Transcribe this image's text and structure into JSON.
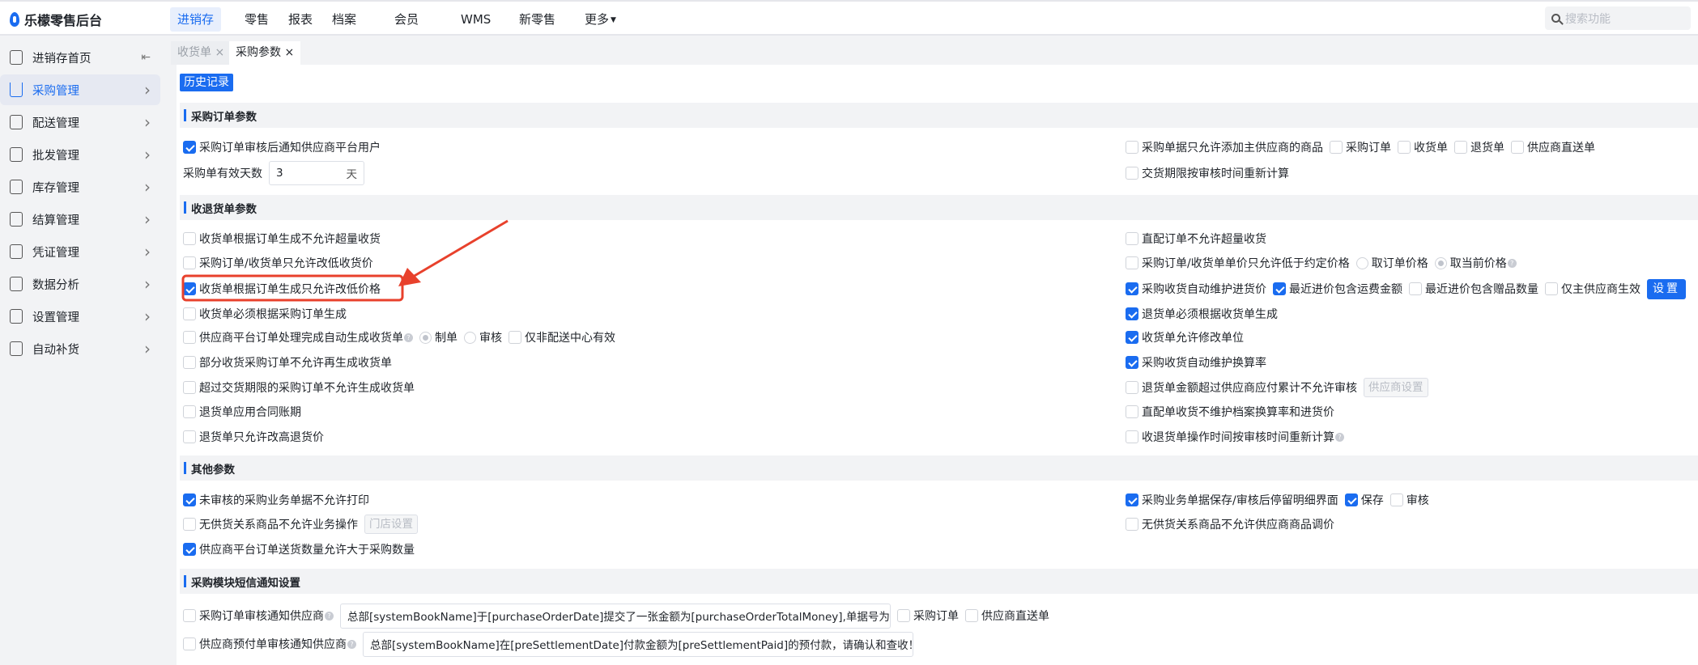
{
  "app": {
    "title": "乐檬零售后台"
  },
  "nav": {
    "items": [
      "进销存",
      "零售",
      "报表",
      "档案",
      "会员",
      "WMS",
      "新零售",
      "更多"
    ],
    "active": 0,
    "search_placeholder": "搜索功能"
  },
  "sidebar": {
    "items": [
      {
        "label": "进销存首页",
        "icon": "home-icon"
      },
      {
        "label": "采购管理",
        "icon": "cart-icon",
        "active": true
      },
      {
        "label": "配送管理",
        "icon": "map-icon"
      },
      {
        "label": "批发管理",
        "icon": "server-icon"
      },
      {
        "label": "库存管理",
        "icon": "box-icon"
      },
      {
        "label": "结算管理",
        "icon": "dollar-icon"
      },
      {
        "label": "凭证管理",
        "icon": "document-icon"
      },
      {
        "label": "数据分析",
        "icon": "chart-line-icon"
      },
      {
        "label": "设置管理",
        "icon": "settings-icon"
      },
      {
        "label": "自动补货",
        "icon": "replenish-icon"
      }
    ]
  },
  "tabs": [
    {
      "label": "收货单",
      "active": false
    },
    {
      "label": "采购参数",
      "active": true
    }
  ],
  "history_button": "历史记录",
  "sections": [
    {
      "title": "采购订单参数",
      "left": [
        [
          {
            "t": "cb",
            "label": "采购订单审核后通知供应商平台用户",
            "on": true
          }
        ],
        [
          {
            "t": "text",
            "label": "采购单有效天数"
          },
          {
            "t": "input",
            "value": "3",
            "unit": "天"
          }
        ]
      ],
      "right": [
        [
          {
            "t": "cb",
            "label": "采购单据只允许添加主供应商的商品"
          },
          {
            "t": "cb",
            "label": "采购订单"
          },
          {
            "t": "cb",
            "label": "收货单"
          },
          {
            "t": "cb",
            "label": "退货单"
          },
          {
            "t": "cb",
            "label": "供应商直送单"
          }
        ],
        [
          {
            "t": "cb",
            "label": "交货期限按审核时间重新计算"
          }
        ]
      ]
    },
    {
      "title": "收退货单参数",
      "left": [
        [
          {
            "t": "cb",
            "label": "收货单根据订单生成不允许超量收货"
          }
        ],
        [
          {
            "t": "cb",
            "label": "采购订单/收货单只允许改低收货价"
          }
        ],
        [
          {
            "t": "cb",
            "label": "收货单根据订单生成只允许改低价格",
            "on": true
          }
        ],
        [
          {
            "t": "cb",
            "label": "收货单必须根据采购订单生成"
          }
        ],
        [
          {
            "t": "cb",
            "label": "供应商平台订单处理完成自动生成收货单",
            "help": true
          },
          {
            "t": "rd",
            "label": "制单",
            "on": true
          },
          {
            "t": "rd",
            "label": "审核"
          },
          {
            "t": "cb",
            "label": "仅非配送中心有效"
          }
        ],
        [
          {
            "t": "cb",
            "label": "部分收货采购订单不允许再生成收货单"
          }
        ],
        [
          {
            "t": "cb",
            "label": "超过交货期限的采购订单不允许生成收货单"
          }
        ],
        [
          {
            "t": "cb",
            "label": "退货单应用合同账期"
          }
        ],
        [
          {
            "t": "cb",
            "label": "退货单只允许改高退货价"
          }
        ]
      ],
      "right": [
        [
          {
            "t": "cb",
            "label": "直配订单不允许超量收货"
          }
        ],
        [
          {
            "t": "cb",
            "label": "采购订单/收货单单价只允许低于约定价格"
          },
          {
            "t": "rd",
            "label": "取订单价格"
          },
          {
            "t": "rd",
            "label": "取当前价格",
            "on": true,
            "help": true
          }
        ],
        [
          {
            "t": "cb",
            "label": "采购收货自动维护进货价",
            "on": true
          },
          {
            "t": "cb",
            "label": "最近进价包含运费金额",
            "on": true
          },
          {
            "t": "cb",
            "label": "最近进价包含赠品数量"
          },
          {
            "t": "cb",
            "label": "仅主供应商生效"
          },
          {
            "t": "bbtn",
            "label": "设置"
          }
        ],
        [
          {
            "t": "cb",
            "label": "退货单必须根据收货单生成",
            "on": true
          }
        ],
        [
          {
            "t": "cb",
            "label": "收货单允许修改单位",
            "on": true
          }
        ],
        [
          {
            "t": "cb",
            "label": "采购收货自动维护换算率",
            "on": true
          }
        ],
        [
          {
            "t": "cb",
            "label": "退货单金额超过供应商应付累计不允许审核"
          },
          {
            "t": "gbtn",
            "label": "供应商设置"
          }
        ],
        [
          {
            "t": "cb",
            "label": "直配单收货不维护档案换算率和进货价"
          }
        ],
        [
          {
            "t": "cb",
            "label": "收退货单操作时间按审核时间重新计算",
            "help": true
          }
        ]
      ]
    },
    {
      "title": "其他参数",
      "left": [
        [
          {
            "t": "cb",
            "label": "未审核的采购业务单据不允许打印",
            "on": true
          }
        ],
        [
          {
            "t": "cb",
            "label": "无供货关系商品不允许业务操作"
          },
          {
            "t": "gbtn",
            "label": "门店设置"
          }
        ],
        [
          {
            "t": "cb",
            "label": "供应商平台订单送货数量允许大于采购数量",
            "on": true
          }
        ]
      ],
      "right": [
        [
          {
            "t": "cb",
            "label": "采购业务单据保存/审核后停留明细界面",
            "on": true
          },
          {
            "t": "cb",
            "label": "保存",
            "on": true
          },
          {
            "t": "cb",
            "label": "审核"
          }
        ],
        [
          {
            "t": "cb",
            "label": "无供货关系商品不允许供应商商品调价"
          }
        ]
      ]
    },
    {
      "title": "采购模块短信通知设置",
      "left": [
        [
          {
            "t": "cb",
            "label": "采购订单审核通知供应商",
            "help": true
          },
          {
            "t": "input",
            "value": "总部[systemBookName]于[purchaseOrderDate]提交了一张金额为[purchaseOrderTotalMoney],单据号为[purc",
            "wide": true
          },
          {
            "t": "cb",
            "label": "采购订单"
          },
          {
            "t": "cb",
            "label": "供应商直送单"
          }
        ],
        [
          {
            "t": "cb",
            "label": "供应商预付单审核通知供应商",
            "help": true
          },
          {
            "t": "input",
            "value": "总部[systemBookName]在[preSettlementDate]付款金额为[preSettlementPaid]的预付款，请确认和查收！",
            "wide": true
          }
        ]
      ],
      "right": []
    }
  ],
  "colors": {
    "accent": "#1a6cf0",
    "annotation": "#e8412c"
  }
}
